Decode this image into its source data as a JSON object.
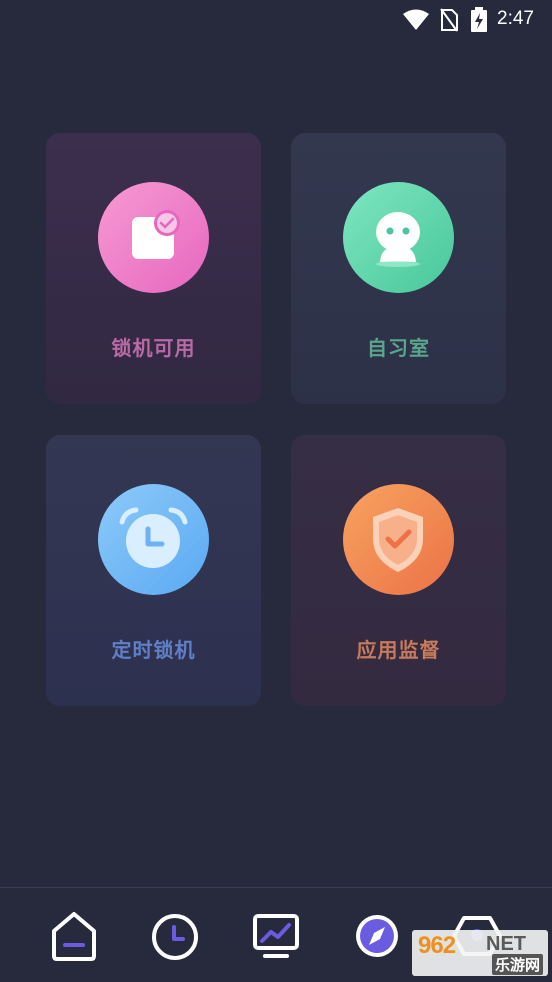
{
  "status_bar": {
    "time": "2:47",
    "icons": [
      "wifi-icon",
      "no-sim-icon",
      "battery-charging-icon"
    ]
  },
  "cards": [
    {
      "label": "锁机可用",
      "icon": "phone-check-icon",
      "color": "#e667c0"
    },
    {
      "label": "自习室",
      "icon": "person-icon",
      "color": "#48c79a"
    },
    {
      "label": "定时锁机",
      "icon": "alarm-clock-icon",
      "color": "#5aa9f2"
    },
    {
      "label": "应用监督",
      "icon": "shield-check-icon",
      "color": "#ec7247"
    }
  ],
  "bottom_nav": [
    "home-icon",
    "clock-icon",
    "stats-icon",
    "compass-icon",
    "profile-icon"
  ],
  "watermark": {
    "logo": "962",
    "net": "NET",
    "cn": "乐游网"
  }
}
